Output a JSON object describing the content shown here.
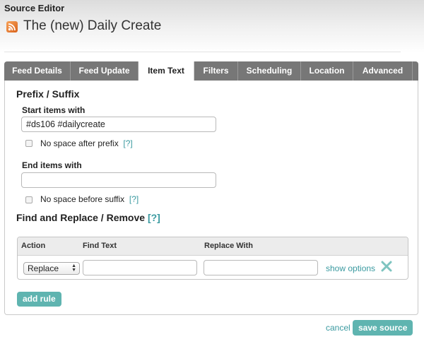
{
  "window": {
    "title": "Source Editor"
  },
  "feed": {
    "title": "The (new) Daily Create"
  },
  "tabs": [
    {
      "label": "Feed Details",
      "active": false
    },
    {
      "label": "Feed Update",
      "active": false
    },
    {
      "label": "Item Text",
      "active": true
    },
    {
      "label": "Filters",
      "active": false
    },
    {
      "label": "Scheduling",
      "active": false
    },
    {
      "label": "Location",
      "active": false
    },
    {
      "label": "Advanced",
      "active": false
    }
  ],
  "prefix_suffix": {
    "heading": "Prefix / Suffix",
    "start_label": "Start items with",
    "start_value": "#ds106 #dailycreate",
    "no_space_prefix_label": "No space after prefix",
    "no_space_prefix_checked": false,
    "end_label": "End items with",
    "end_value": "",
    "no_space_suffix_label": "No space before suffix",
    "no_space_suffix_checked": false,
    "help": "[?]"
  },
  "find_replace": {
    "heading": "Find and Replace / Remove",
    "help": "[?]",
    "columns": {
      "action": "Action",
      "find": "Find Text",
      "replace": "Replace With"
    },
    "rows": [
      {
        "action": "Replace",
        "find": "",
        "replace": "",
        "options_label": "show options"
      }
    ],
    "add_rule_label": "add rule"
  },
  "footer": {
    "cancel_label": "cancel",
    "save_label": "save source"
  },
  "colors": {
    "accent": "#5fb4b0",
    "link": "#3a9aa0",
    "tab_bar": "#777777",
    "rss": "#e8741f"
  }
}
